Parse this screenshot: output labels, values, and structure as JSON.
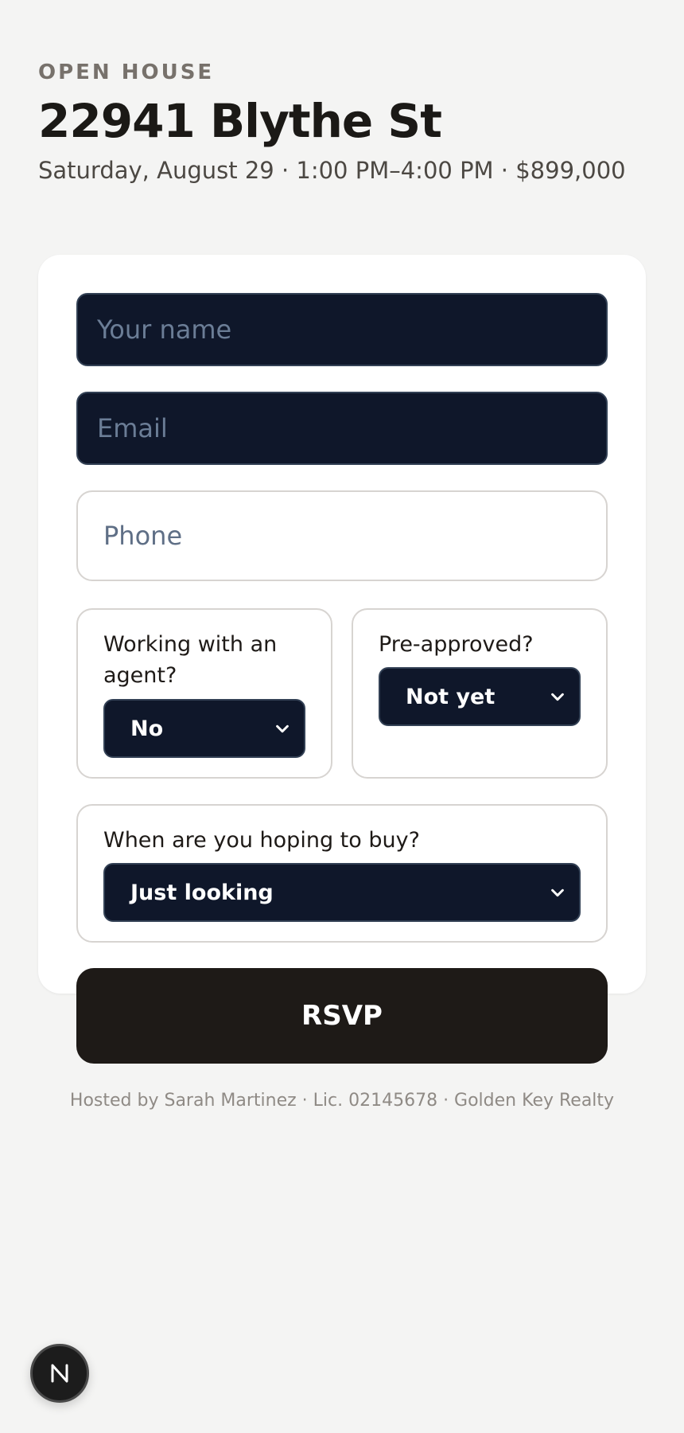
{
  "header": {
    "eyebrow": "OPEN HOUSE",
    "title": "22941 Blythe St",
    "subtitle": "Saturday, August 29 · 1:00 PM–4:00 PM · $899,000"
  },
  "form": {
    "name": {
      "placeholder": "Your name",
      "value": ""
    },
    "email": {
      "placeholder": "Email",
      "value": ""
    },
    "phone": {
      "placeholder": "Phone",
      "value": ""
    },
    "agent": {
      "label": "Working with an agent?",
      "selected": "No"
    },
    "preapproved": {
      "label": "Pre-approved?",
      "selected": "Not yet"
    },
    "timeline": {
      "label": "When are you hoping to buy?",
      "selected": "Just looking"
    },
    "submit_label": "RSVP"
  },
  "footer": {
    "text": "Hosted by Sarah Martinez · Lic. 02145678 · Golden Key Realty"
  },
  "badge": {
    "icon": "n-logo-icon"
  },
  "colors": {
    "background": "#f4f4f3",
    "card": "#ffffff",
    "input_dark": "#0f172a",
    "button": "#1e1a17",
    "muted_text": "#8f8a85"
  }
}
